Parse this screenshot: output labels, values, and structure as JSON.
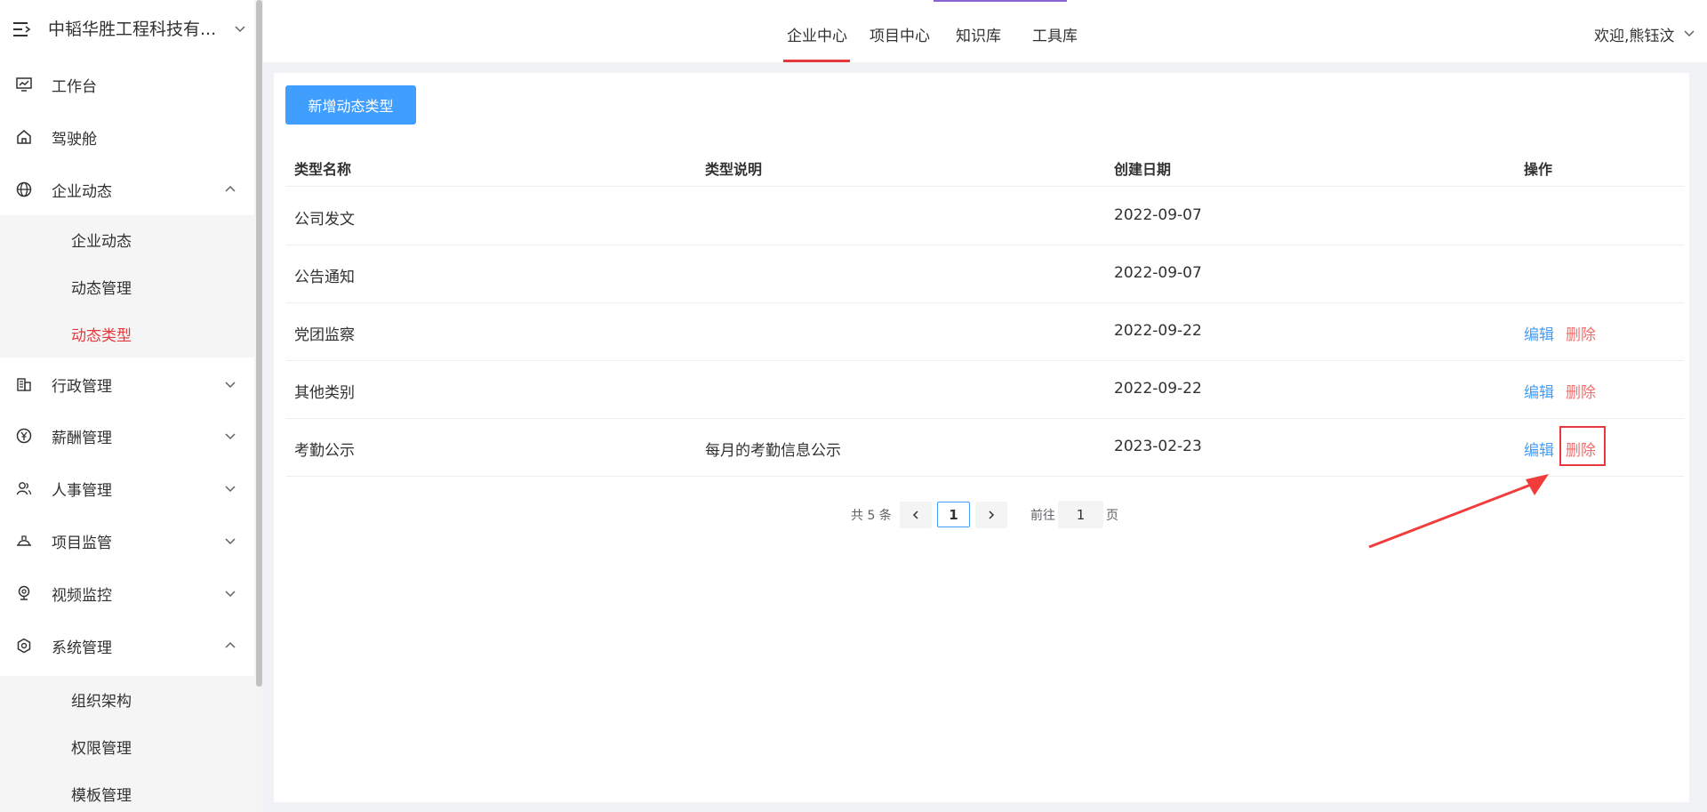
{
  "sidebar": {
    "company": "中韬华胜工程科技有...",
    "items": [
      {
        "label": "工作台"
      },
      {
        "label": "驾驶舱"
      },
      {
        "label": "企业动态"
      },
      {
        "label": "行政管理"
      },
      {
        "label": "薪酬管理"
      },
      {
        "label": "人事管理"
      },
      {
        "label": "项目监管"
      },
      {
        "label": "视频监控"
      },
      {
        "label": "系统管理"
      }
    ],
    "enterprise_sub": [
      {
        "label": "企业动态"
      },
      {
        "label": "动态管理"
      },
      {
        "label": "动态类型"
      }
    ],
    "system_sub": [
      {
        "label": "组织架构"
      },
      {
        "label": "权限管理"
      },
      {
        "label": "模板管理"
      }
    ]
  },
  "topnav": {
    "tabs": [
      {
        "label": "企业中心"
      },
      {
        "label": "项目中心"
      },
      {
        "label": "知识库"
      },
      {
        "label": "工具库"
      }
    ],
    "welcome": "欢迎,熊钰汶"
  },
  "main": {
    "add_button": "新增动态类型",
    "columns": [
      "类型名称",
      "类型说明",
      "创建日期",
      "操作"
    ],
    "rows": [
      {
        "name": "公司发文",
        "desc": "",
        "date": "2022-09-07",
        "edit": "",
        "del": ""
      },
      {
        "name": "公告通知",
        "desc": "",
        "date": "2022-09-07",
        "edit": "",
        "del": ""
      },
      {
        "name": "党团监察",
        "desc": "",
        "date": "2022-09-22",
        "edit": "编辑",
        "del": "删除"
      },
      {
        "name": "其他类别",
        "desc": "",
        "date": "2022-09-22",
        "edit": "编辑",
        "del": "删除"
      },
      {
        "name": "考勤公示",
        "desc": "每月的考勤信息公示",
        "date": "2023-02-23",
        "edit": "编辑",
        "del": "删除"
      }
    ],
    "pagination": {
      "total": "共 5 条",
      "current": "1",
      "goto_label": "前往",
      "goto_value": "1",
      "page_label": "页"
    }
  },
  "colors": {
    "primary": "#409eff",
    "danger": "#f56c6c",
    "active": "#e6393d",
    "highlight_annotation": "#e6393d"
  },
  "icons": {
    "menu_toggle": "menu-fold-icon",
    "items": [
      "monitor-chart-icon",
      "home-icon",
      "globe-icon",
      "building-icon",
      "yen-coin-icon",
      "users-icon",
      "helmet-icon",
      "camera-icon",
      "hexagon-gear-icon"
    ]
  }
}
